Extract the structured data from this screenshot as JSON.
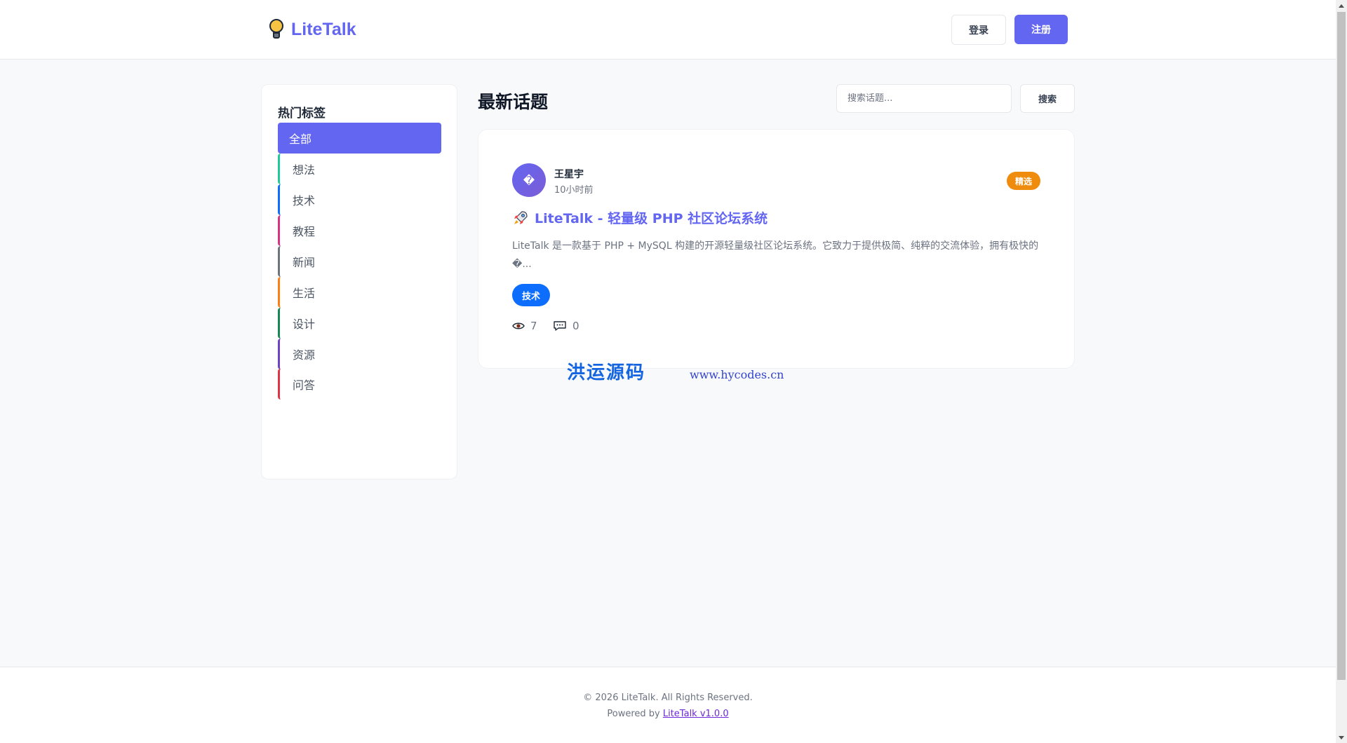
{
  "header": {
    "logo_text": "LiteTalk",
    "login_label": "登录",
    "register_label": "注册"
  },
  "sidebar": {
    "title": "热门标签",
    "tags": [
      {
        "label": "全部",
        "color": "#6366f1",
        "active": true
      },
      {
        "label": "想法",
        "color": "#20c997"
      },
      {
        "label": "技术",
        "color": "#0d6efd"
      },
      {
        "label": "教程",
        "color": "#d63384"
      },
      {
        "label": "新闻",
        "color": "#6c757d"
      },
      {
        "label": "生活",
        "color": "#fd7e14"
      },
      {
        "label": "设计",
        "color": "#198754"
      },
      {
        "label": "资源",
        "color": "#6f42c1"
      },
      {
        "label": "问答",
        "color": "#dc3545"
      }
    ]
  },
  "main": {
    "title": "最新话题",
    "search_placeholder": "搜索话题...",
    "search_label": "搜索"
  },
  "post": {
    "avatar_char": "�",
    "author": "王星宇",
    "time": "10小时前",
    "badge": "精选",
    "title": "LiteTalk - 轻量级 PHP 社区论坛系统",
    "excerpt": "LiteTalk 是一款基于 PHP + MySQL 构建的开源轻量级社区论坛系统。它致力于提供极简、纯粹的交流体验，拥有极快的�...",
    "tag": "技术",
    "views": "7",
    "comments": "0"
  },
  "watermark": {
    "cn": "洪运源码",
    "url": "www.hycodes.cn"
  },
  "footer": {
    "copyright": "© 2026 LiteTalk. All Rights Reserved.",
    "powered_prefix": "Powered by ",
    "powered_link": "LiteTalk v1.0.0"
  }
}
